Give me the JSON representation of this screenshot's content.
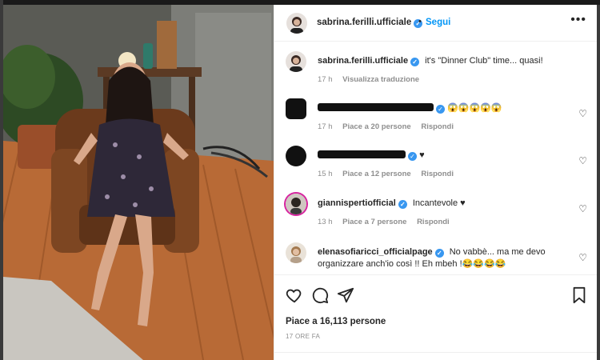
{
  "post": {
    "author": "sabrina.ferilli.ufficiale",
    "follow_label": "Segui",
    "dot": "•",
    "more_label": "•••",
    "caption": "it's \"Dinner Club\" time... quasi!",
    "caption_time": "17 h",
    "translate_label": "Visualizza traduzione"
  },
  "comments": [
    {
      "user": "",
      "text": "😱😱😱😱😱",
      "time": "17 h",
      "likes": "Piace a 20 persone",
      "reply": "Rispondi"
    },
    {
      "user": "",
      "text": "♥",
      "time": "15 h",
      "likes": "Piace a 12 persone",
      "reply": "Rispondi"
    },
    {
      "user": "giannispertiofficial",
      "text": "Incantevole ♥",
      "time": "13 h",
      "likes": "Piace a 7 persone",
      "reply": "Rispondi"
    },
    {
      "user": "elenasofiaricci_officialpage",
      "text": "No vabbè... ma me devo organizzare anch'io così !! Eh mbeh !😂😂😂😂",
      "time": "",
      "likes": "",
      "reply": ""
    }
  ],
  "footer": {
    "likes": "Piace a 16,113 persone",
    "timestamp": "17 ORE FA"
  },
  "icons": {
    "like": "heart-icon",
    "comment": "comment-icon",
    "share": "share-icon",
    "save": "bookmark-icon",
    "more": "more-options-icon",
    "verified": "verified-badge-icon"
  },
  "colors": {
    "accent": "#0095f6",
    "verified": "#3897f0",
    "text": "#262626",
    "secondary": "#8e8e8e"
  }
}
